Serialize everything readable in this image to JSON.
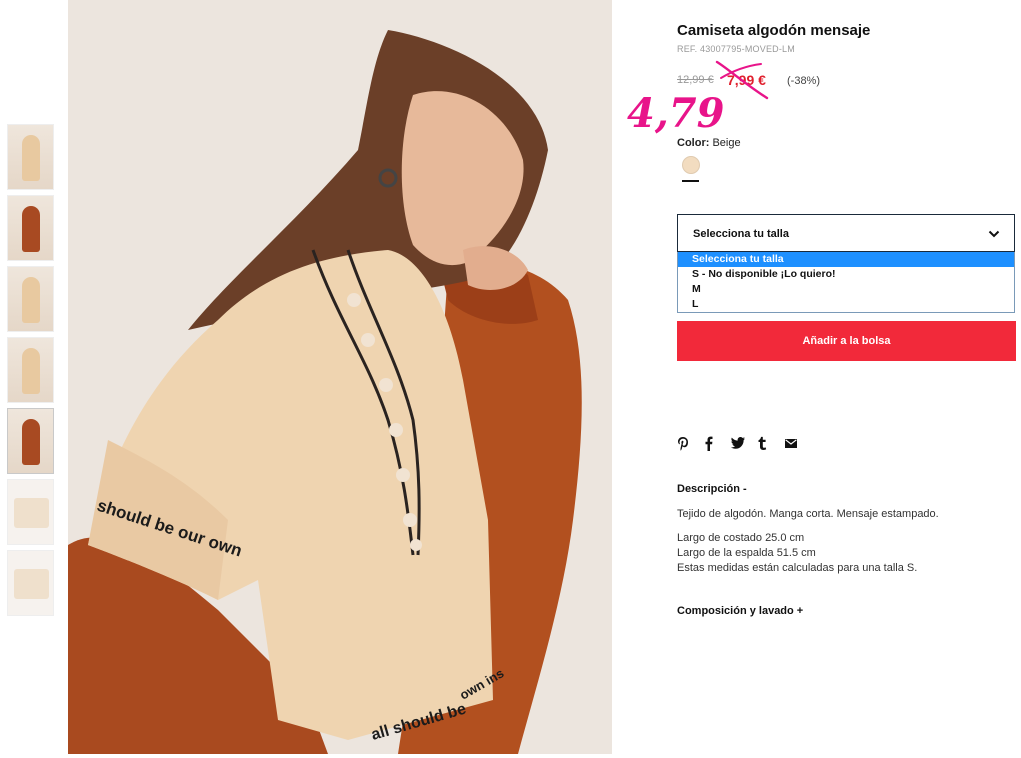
{
  "thumbnails": [
    "thumb-1",
    "thumb-2",
    "thumb-3",
    "thumb-4",
    "thumb-5",
    "thumb-6",
    "thumb-7"
  ],
  "product": {
    "title": "Camiseta algodón mensaje",
    "ref": "REF. 43007795-MOVED-LM",
    "old_price": "12,99 €",
    "sale_price": "7,99 €",
    "discount": "(-38%)",
    "handwritten_price": "4,79",
    "handwritten_color": "#e8148a"
  },
  "color": {
    "label": "Color:",
    "value": "Beige",
    "swatch": "#f2dcc0"
  },
  "size_select": {
    "selected": "Selecciona tu talla",
    "options": [
      "Selecciona tu talla",
      "S - No disponible ¡Lo quiero!",
      "M",
      "L"
    ]
  },
  "add_to_bag": "Añadir a la bolsa",
  "accent_color": "#f2293a",
  "share_icons": [
    "pinterest-icon",
    "facebook-icon",
    "twitter-icon",
    "tumblr-icon",
    "email-icon"
  ],
  "description": {
    "title": "Descripción -",
    "text": "Tejido de algodón. Manga corta. Mensaje estampado.",
    "measures": [
      "Largo de costado 25.0 cm",
      "Largo de la espalda 51.5 cm",
      "Estas medidas están calculadas para una talla S."
    ]
  },
  "composition": {
    "title": "Composición y lavado +"
  },
  "photo": {
    "sleeve_text": "should be our own",
    "hem_text_1": "all should be",
    "hem_text_2": "own ins"
  }
}
